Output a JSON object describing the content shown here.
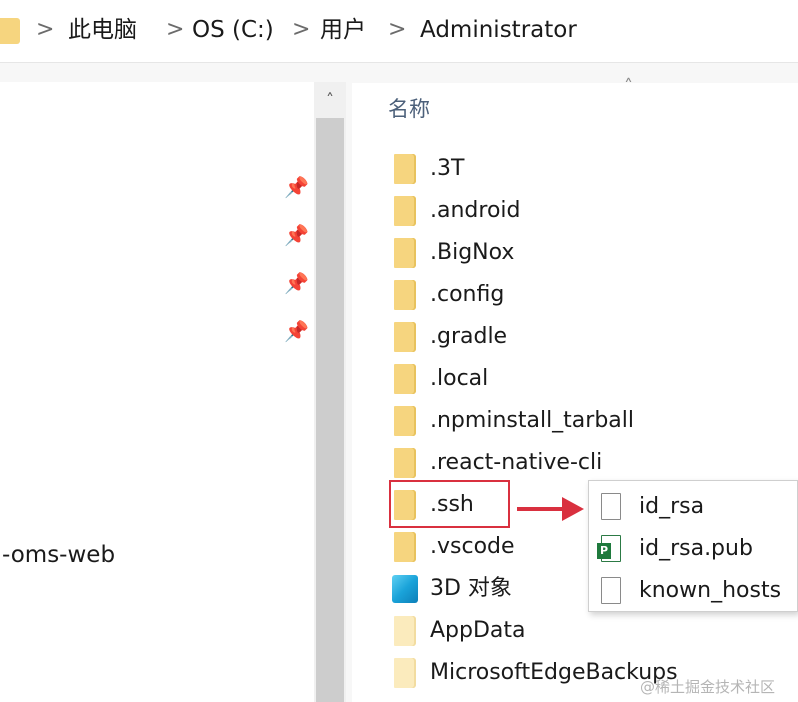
{
  "breadcrumb": {
    "items": [
      "此电脑",
      "OS (C:)",
      "用户",
      "Administrator"
    ],
    "separator": ">"
  },
  "nav": {
    "partial_item": "-oms-web",
    "pin_icon_count": 4
  },
  "column_header": "名称",
  "files": [
    {
      "name": ".3T",
      "icon": "folder-icon"
    },
    {
      "name": ".android",
      "icon": "folder-icon"
    },
    {
      "name": ".BigNox",
      "icon": "folder-icon"
    },
    {
      "name": ".config",
      "icon": "folder-icon"
    },
    {
      "name": ".gradle",
      "icon": "folder-icon"
    },
    {
      "name": ".local",
      "icon": "folder-icon"
    },
    {
      "name": ".npminstall_tarball",
      "icon": "folder-icon"
    },
    {
      "name": ".react-native-cli",
      "icon": "folder-icon"
    },
    {
      "name": ".ssh",
      "icon": "folder-icon",
      "highlighted": true
    },
    {
      "name": ".vscode",
      "icon": "folder-icon"
    },
    {
      "name": "3D 对象",
      "icon": "3d-objects-icon"
    },
    {
      "name": "AppData",
      "icon": "hidden-folder-icon"
    },
    {
      "name": "MicrosoftEdgeBackups",
      "icon": "hidden-folder-icon"
    }
  ],
  "ssh_contents": [
    {
      "name": "id_rsa",
      "icon": "file-icon"
    },
    {
      "name": "id_rsa.pub",
      "icon": "publisher-file-icon"
    },
    {
      "name": "known_hosts",
      "icon": "file-icon"
    }
  ],
  "annotation": {
    "color": "#d9303f"
  },
  "watermark": "@稀土掘金技术社区",
  "colors": {
    "folder": "#f6d57f",
    "header_text": "#4c607a"
  }
}
